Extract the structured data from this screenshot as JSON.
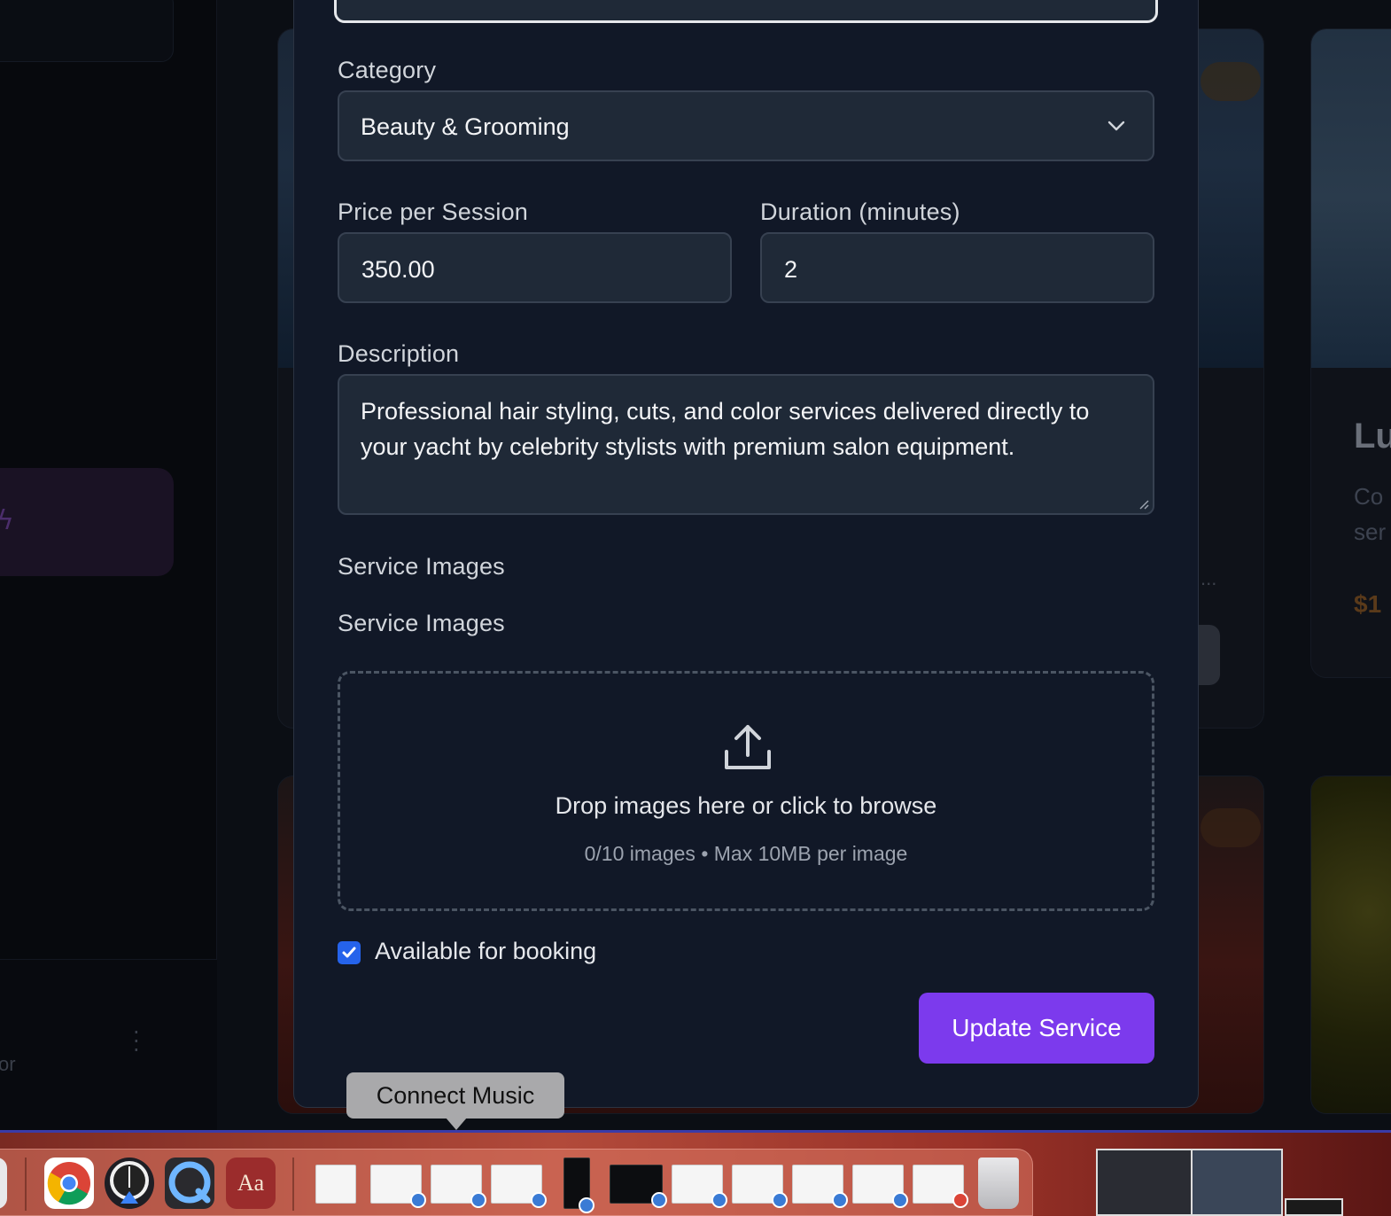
{
  "modal": {
    "category_label": "Category",
    "category_value": "Beauty & Grooming",
    "price_label": "Price per Session",
    "price_value": "350.00",
    "duration_label": "Duration (minutes)",
    "duration_value": "2",
    "description_label": "Description",
    "description_value": "Professional hair styling, cuts, and color services delivered directly to your yacht by celebrity stylists with premium salon equipment.",
    "images_section_label": "Service Images",
    "images_label": "Service Images",
    "dropzone_title": "Drop images here or click to browse",
    "dropzone_subtitle": "0/10 images • Max 10MB per image",
    "available_label": "Available for booking",
    "available_checked": true,
    "submit_label": "Update Service"
  },
  "background": {
    "card_title_partial": "Lu",
    "card_desc_partial_1": "Co",
    "card_desc_partial_2": "ser",
    "card_price_partial": "$1",
    "sidebar_text_partial": "or"
  },
  "dock": {
    "tooltip": "Connect Music",
    "items": [
      "chrome-icon",
      "instruments-icon",
      "quicktime-icon",
      "dictionary-icon"
    ],
    "dictionary_glyph": "Aa"
  },
  "colors": {
    "accent": "#7c3aed",
    "checkbox": "#2563eb",
    "modal_bg": "#111827",
    "input_bg": "#1f2937"
  }
}
